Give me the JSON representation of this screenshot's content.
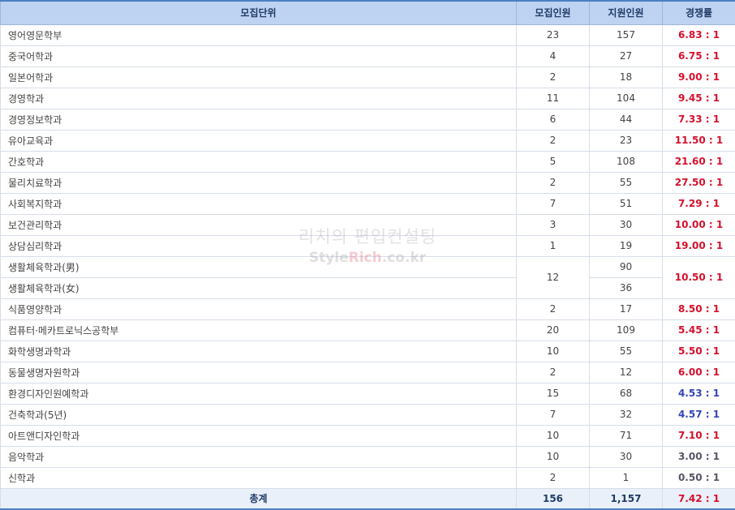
{
  "headers": {
    "unit": "모집단위",
    "recruit": "모집인원",
    "applicants": "지원인원",
    "ratio": "경쟁률"
  },
  "rows": [
    {
      "name": "영어영문학부",
      "recruit": "23",
      "applicants": "157",
      "ratio": "6.83 : 1",
      "ratio_color": "red"
    },
    {
      "name": "중국어학과",
      "recruit": "4",
      "applicants": "27",
      "ratio": "6.75 : 1",
      "ratio_color": "red"
    },
    {
      "name": "일본어학과",
      "recruit": "2",
      "applicants": "18",
      "ratio": "9.00 : 1",
      "ratio_color": "red"
    },
    {
      "name": "경영학과",
      "recruit": "11",
      "applicants": "104",
      "ratio": "9.45 : 1",
      "ratio_color": "red"
    },
    {
      "name": "경영정보학과",
      "recruit": "6",
      "applicants": "44",
      "ratio": "7.33 : 1",
      "ratio_color": "red"
    },
    {
      "name": "유아교육과",
      "recruit": "2",
      "applicants": "23",
      "ratio": "11.50 : 1",
      "ratio_color": "red"
    },
    {
      "name": "간호학과",
      "recruit": "5",
      "applicants": "108",
      "ratio": "21.60 : 1",
      "ratio_color": "red"
    },
    {
      "name": "물리치료학과",
      "recruit": "2",
      "applicants": "55",
      "ratio": "27.50 : 1",
      "ratio_color": "red"
    },
    {
      "name": "사회복지학과",
      "recruit": "7",
      "applicants": "51",
      "ratio": "7.29 : 1",
      "ratio_color": "red"
    },
    {
      "name": "보건관리학과",
      "recruit": "3",
      "applicants": "30",
      "ratio": "10.00 : 1",
      "ratio_color": "red"
    },
    {
      "name": "상담심리학과",
      "recruit": "1",
      "applicants": "19",
      "ratio": "19.00 : 1",
      "ratio_color": "red"
    }
  ],
  "merged": {
    "names": [
      "생활체육학과(男)",
      "생활체육학과(女)"
    ],
    "applicants": [
      "90",
      "36"
    ],
    "recruit": "12",
    "ratio": "10.50 : 1",
    "ratio_color": "red"
  },
  "rows2": [
    {
      "name": "식품영양학과",
      "recruit": "2",
      "applicants": "17",
      "ratio": "8.50 : 1",
      "ratio_color": "red"
    },
    {
      "name": "컴퓨터·메카트로닉스공학부",
      "recruit": "20",
      "applicants": "109",
      "ratio": "5.45 : 1",
      "ratio_color": "red"
    },
    {
      "name": "화학생명과학과",
      "recruit": "10",
      "applicants": "55",
      "ratio": "5.50 : 1",
      "ratio_color": "red"
    },
    {
      "name": "동물생명자원학과",
      "recruit": "2",
      "applicants": "12",
      "ratio": "6.00 : 1",
      "ratio_color": "red"
    },
    {
      "name": "환경디자인원예학과",
      "recruit": "15",
      "applicants": "68",
      "ratio": "4.53 : 1",
      "ratio_color": "blue"
    },
    {
      "name": "건축학과(5년)",
      "recruit": "7",
      "applicants": "32",
      "ratio": "4.57 : 1",
      "ratio_color": "blue"
    },
    {
      "name": "아트앤디자인학과",
      "recruit": "10",
      "applicants": "71",
      "ratio": "7.10 : 1",
      "ratio_color": "red"
    },
    {
      "name": "음악학과",
      "recruit": "10",
      "applicants": "30",
      "ratio": "3.00 : 1",
      "ratio_color": "gray"
    },
    {
      "name": "신학과",
      "recruit": "2",
      "applicants": "1",
      "ratio": "0.50 : 1",
      "ratio_color": "gray"
    }
  ],
  "total": {
    "label": "총계",
    "recruit": "156",
    "applicants": "1,157",
    "ratio": "7.42 : 1"
  },
  "watermark": {
    "line1": "리치의 편입컨설팅",
    "line2_prefix": "Style",
    "line2_highlight": "Rich",
    "line2_suffix": ".co.kr"
  },
  "colors": {
    "header_bg": "#bed3f2",
    "border_accent": "#4f7fc4",
    "ratio_red": "#d6102c",
    "ratio_blue": "#3344b8",
    "ratio_gray": "#555566",
    "footer_bg": "#e9f0fa"
  }
}
